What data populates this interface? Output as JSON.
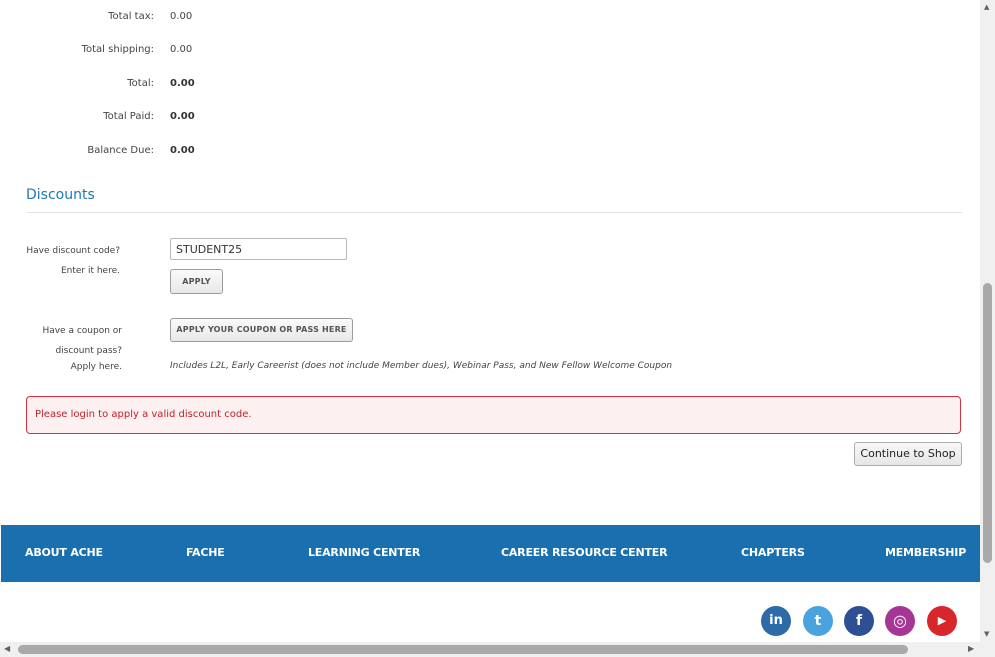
{
  "summary": [
    {
      "label": "Total tax:",
      "value": "0.00",
      "bold": false
    },
    {
      "label": "Total shipping:",
      "value": "0.00",
      "bold": false
    },
    {
      "label": "Total:",
      "value": "0.00",
      "bold": true
    },
    {
      "label": "Total Paid:",
      "value": "0.00",
      "bold": true
    },
    {
      "label": "Balance Due:",
      "value": "0.00",
      "bold": true
    }
  ],
  "discounts": {
    "title": "Discounts",
    "code_label_1": "Have discount code?",
    "code_label_2": "Enter it here.",
    "code_value": "STUDENT25",
    "apply_label": "APPLY",
    "coupon_label_1": "Have a coupon or",
    "coupon_label_2": "discount pass?",
    "coupon_label_3": "Apply here.",
    "coupon_button": "APPLY YOUR COUPON OR PASS HERE",
    "coupon_note": "Includes L2L, Early Careerist (does not include Member dues), Webinar Pass, and New Fellow Welcome Coupon"
  },
  "alert": {
    "message": "Please login to apply a valid discount code."
  },
  "continue_label": "Continue to Shop",
  "footer_nav": [
    "ABOUT ACHE",
    "FACHE",
    "LEARNING CENTER",
    "CAREER RESOURCE CENTER",
    "CHAPTERS",
    "MEMBERSHIP"
  ],
  "social": [
    {
      "icon": "linkedin-icon",
      "glyph": "in",
      "color": "#2d6aa8"
    },
    {
      "icon": "twitter-icon",
      "glyph": "t",
      "color": "#4aa3df"
    },
    {
      "icon": "facebook-icon",
      "glyph": "f",
      "color": "#2f4f94"
    },
    {
      "icon": "instagram-icon",
      "glyph": "◎",
      "color": "#a53695"
    },
    {
      "icon": "youtube-icon",
      "glyph": "▶",
      "color": "#d9262b"
    }
  ],
  "colors": {
    "accent": "#1a7bb0",
    "footer": "#1a6fae",
    "error": "#c0222b"
  }
}
